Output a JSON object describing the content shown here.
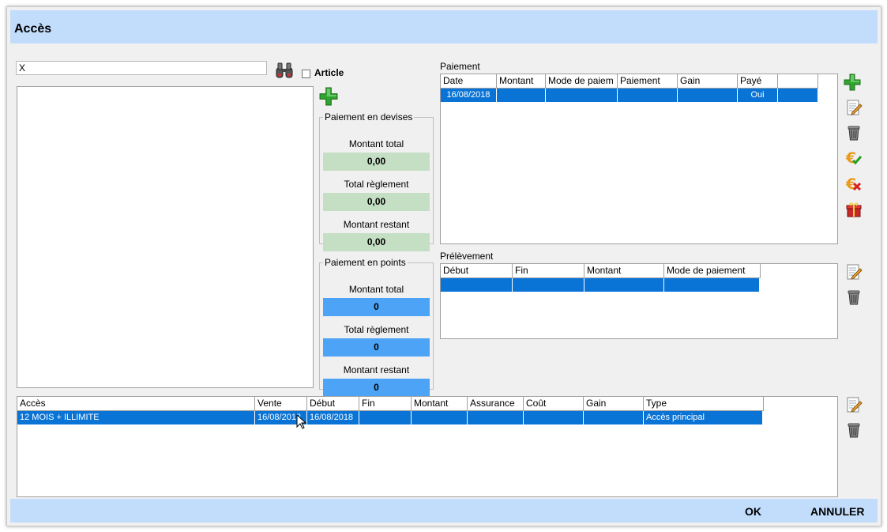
{
  "window": {
    "title": "Accès"
  },
  "search": {
    "value": "X"
  },
  "article": {
    "label": "Article",
    "checked": false
  },
  "devises": {
    "legend": "Paiement en devises",
    "total_label": "Montant total",
    "total_value": "0,00",
    "reglement_label": "Total règlement",
    "reglement_value": "0,00",
    "restant_label": "Montant restant",
    "restant_value": "0,00"
  },
  "points": {
    "legend": "Paiement en points",
    "total_label": "Montant total",
    "total_value": "0",
    "reglement_label": "Total règlement",
    "reglement_value": "0",
    "restant_label": "Montant restant",
    "restant_value": "0"
  },
  "paiement": {
    "title": "Paiement",
    "columns": [
      "Date",
      "Montant",
      "Mode de paiem",
      "Paiement",
      "Gain",
      "Payé",
      ""
    ],
    "row": [
      "16/08/2018",
      "",
      "",
      "",
      "",
      "Oui"
    ]
  },
  "prelevement": {
    "title": "Prélèvement",
    "columns": [
      "Début",
      "Fin",
      "Montant",
      "Mode de paiement"
    ],
    "row": [
      "",
      "",
      "",
      ""
    ]
  },
  "acces": {
    "columns": [
      "Accès",
      "Vente",
      "Début",
      "Fin",
      "Montant",
      "Assurance",
      "Coût",
      "Gain",
      "Type"
    ],
    "row": [
      "12 MOIS + ILLIMITE",
      "16/08/2018",
      "16/08/2018",
      "",
      "",
      "",
      "",
      "",
      "Accès principal"
    ]
  },
  "buttons": {
    "ok": "OK",
    "cancel": "ANNULER"
  },
  "colors": {
    "title_bar": "#c2dcfb",
    "selected_row": "#0a74d6",
    "green_box": "#c4dfc4",
    "blue_box": "#4da3f5"
  }
}
